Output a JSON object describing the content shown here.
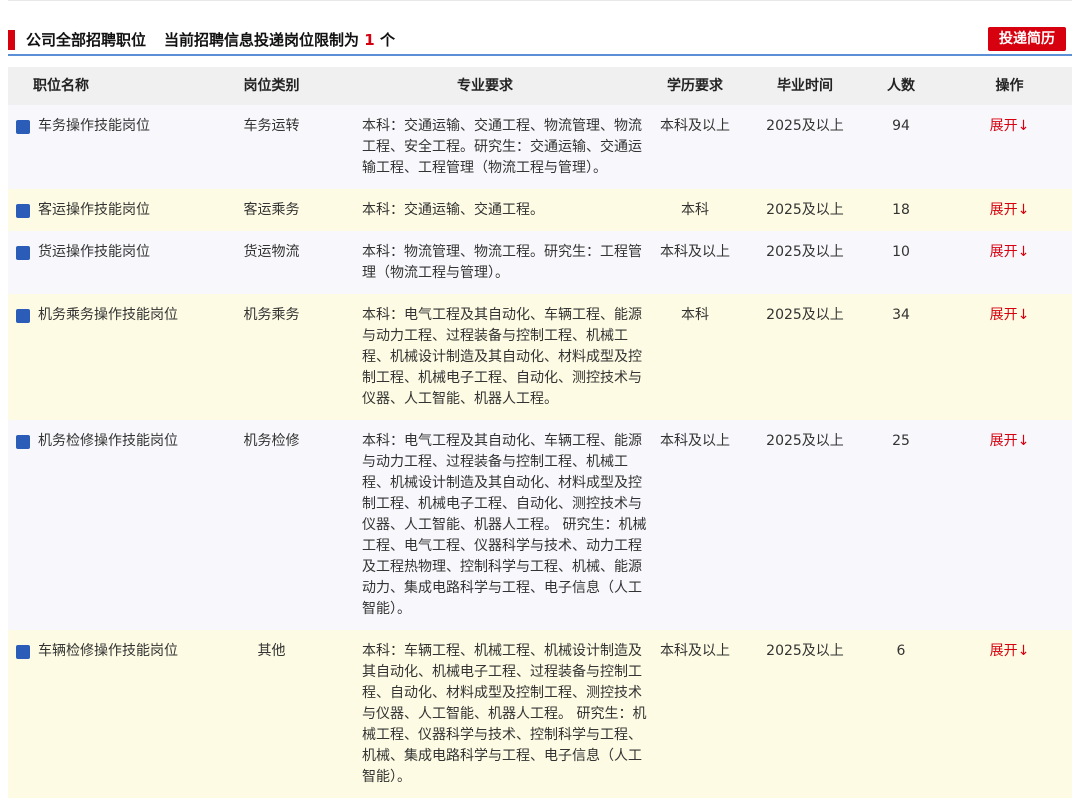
{
  "header": {
    "title_main": "公司全部招聘职位",
    "title_note_prefix": "当前招聘信息投递岗位限制为",
    "title_limit": "1",
    "title_note_suffix": "个",
    "apply_button": "投递简历"
  },
  "table": {
    "columns": [
      "职位名称",
      "岗位类别",
      "专业要求",
      "学历要求",
      "毕业时间",
      "人数",
      "操作"
    ],
    "rows": [
      {
        "name": "车务操作技能岗位",
        "type": "车务运转",
        "major": "本科：交通运输、交通工程、物流管理、物流工程、安全工程。研究生：交通运输、交通运输工程、工程管理（物流工程与管理）。",
        "education": "本科及以上",
        "graduation": "2025及以上",
        "count": "94",
        "action": "展开↓"
      },
      {
        "name": "客运操作技能岗位",
        "type": "客运乘务",
        "major": "本科：交通运输、交通工程。",
        "education": "本科",
        "graduation": "2025及以上",
        "count": "18",
        "action": "展开↓"
      },
      {
        "name": "货运操作技能岗位",
        "type": "货运物流",
        "major": "本科：物流管理、物流工程。研究生：工程管理（物流工程与管理）。",
        "education": "本科及以上",
        "graduation": "2025及以上",
        "count": "10",
        "action": "展开↓"
      },
      {
        "name": "机务乘务操作技能岗位",
        "type": "机务乘务",
        "major": "本科：电气工程及其自动化、车辆工程、能源与动力工程、过程装备与控制工程、机械工程、机械设计制造及其自动化、材料成型及控制工程、机械电子工程、自动化、测控技术与仪器、人工智能、机器人工程。",
        "education": "本科",
        "graduation": "2025及以上",
        "count": "34",
        "action": "展开↓"
      },
      {
        "name": "机务检修操作技能岗位",
        "type": "机务检修",
        "major": "本科：电气工程及其自动化、车辆工程、能源与动力工程、过程装备与控制工程、机械工程、机械设计制造及其自动化、材料成型及控制工程、机械电子工程、自动化、测控技术与仪器、人工智能、机器人工程。 研究生：机械工程、电气工程、仪器科学与技术、动力工程及工程热物理、控制科学与工程、机械、能源动力、集成电路科学与工程、电子信息（人工智能）。",
        "education": "本科及以上",
        "graduation": "2025及以上",
        "count": "25",
        "action": "展开↓"
      },
      {
        "name": "车辆检修操作技能岗位",
        "type": "其他",
        "major": "本科：车辆工程、机械工程、机械设计制造及其自动化、机械电子工程、过程装备与控制工程、自动化、材料成型及控制工程、测控技术与仪器、人工智能、机器人工程。 研究生：机械工程、仪器科学与技术、控制科学与工程、机械、集成电路科学与工程、电子信息（人工智能）。",
        "education": "本科及以上",
        "graduation": "2025及以上",
        "count": "6",
        "action": "展开↓"
      }
    ]
  },
  "colors": {
    "accent_red": "#d6000f",
    "square_blue": "#2b5cb8",
    "header_underline": "#5b8fd6",
    "row_odd_bg": "#f8f8fc",
    "row_even_bg": "#fdfbe3"
  },
  "icons": {
    "row_marker": "blue-square-icon"
  }
}
